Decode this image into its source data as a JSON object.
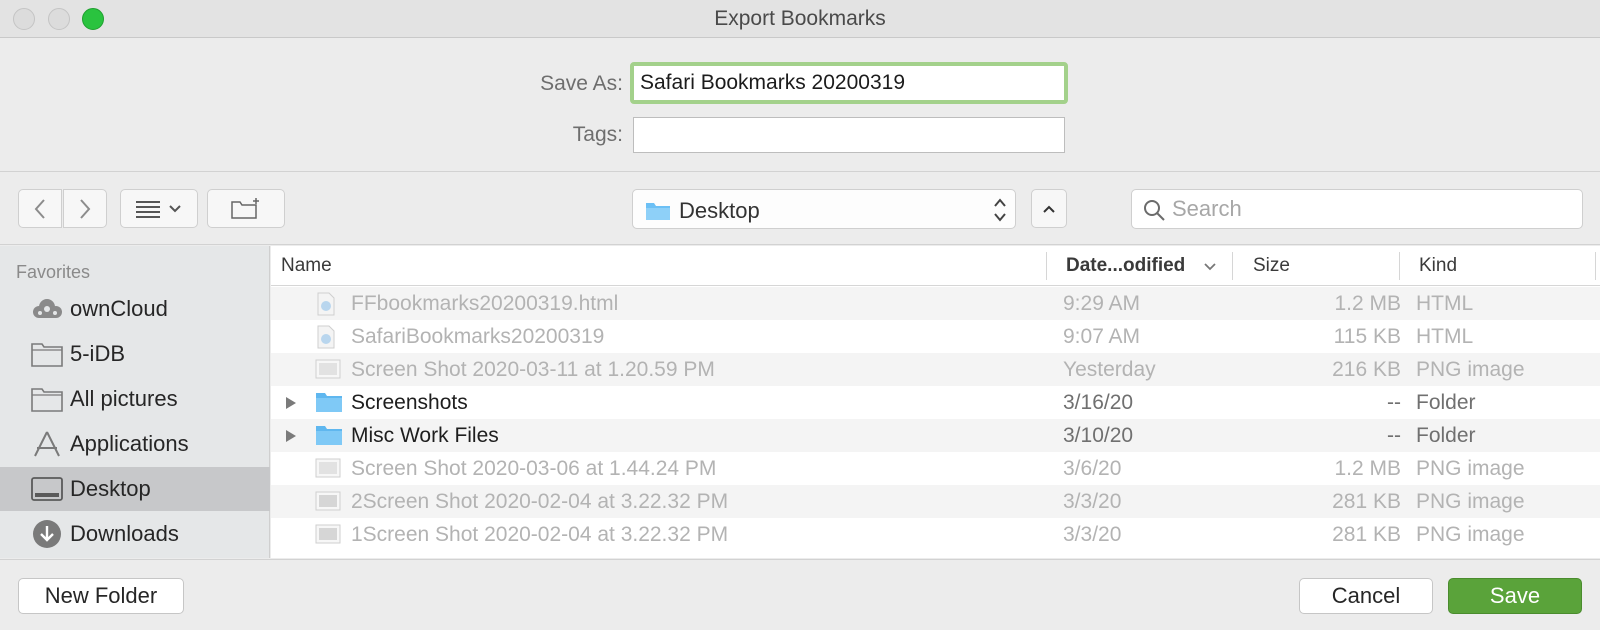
{
  "window": {
    "title": "Export Bookmarks"
  },
  "saveas": {
    "save_as_label": "Save As:",
    "save_as_value": "Safari Bookmarks 20200319",
    "tags_label": "Tags:",
    "tags_value": ""
  },
  "toolbar": {
    "location": "Desktop",
    "search_placeholder": "Search"
  },
  "sidebar": {
    "heading": "Favorites",
    "items": [
      {
        "label": "ownCloud",
        "icon": "cloud-icon"
      },
      {
        "label": "5-iDB",
        "icon": "folder-icon"
      },
      {
        "label": "All pictures",
        "icon": "folder-icon"
      },
      {
        "label": "Applications",
        "icon": "applications-icon"
      },
      {
        "label": "Desktop",
        "icon": "desktop-icon",
        "selected": true
      },
      {
        "label": "Downloads",
        "icon": "downloads-icon"
      }
    ]
  },
  "filelist": {
    "columns": [
      "Name",
      "Date...odified",
      "Size",
      "Kind"
    ],
    "rows": [
      {
        "name": "FFbookmarks20200319.html",
        "date": "9:29 AM",
        "size": "1.2 MB",
        "kind": "HTML",
        "type": "html",
        "enabled": false
      },
      {
        "name": "SafariBookmarks20200319",
        "date": "9:07 AM",
        "size": "115 KB",
        "kind": "HTML",
        "type": "html",
        "enabled": false
      },
      {
        "name": "Screen Shot 2020-03-11 at 1.20.59 PM",
        "date": "Yesterday",
        "size": "216 KB",
        "kind": "PNG image",
        "type": "image",
        "enabled": false
      },
      {
        "name": "Screenshots",
        "date": "3/16/20",
        "size": "--",
        "kind": "Folder",
        "type": "folder",
        "enabled": true
      },
      {
        "name": "Misc Work Files",
        "date": "3/10/20",
        "size": "--",
        "kind": "Folder",
        "type": "folder",
        "enabled": true
      },
      {
        "name": "Screen Shot 2020-03-06 at 1.44.24 PM",
        "date": "3/6/20",
        "size": "1.2 MB",
        "kind": "PNG image",
        "type": "image",
        "enabled": false
      },
      {
        "name": "2Screen Shot 2020-02-04 at 3.22.32 PM",
        "date": "3/3/20",
        "size": "281 KB",
        "kind": "PNG image",
        "type": "image",
        "enabled": false
      },
      {
        "name": "1Screen Shot 2020-02-04 at 3.22.32 PM",
        "date": "3/3/20",
        "size": "281 KB",
        "kind": "PNG image",
        "type": "image",
        "enabled": false
      }
    ]
  },
  "buttons": {
    "new_folder": "New Folder",
    "cancel": "Cancel",
    "save": "Save"
  },
  "colors": {
    "accent_green": "#5aa33a",
    "focus_ring": "#a3d18b",
    "folder_blue": "#6cc0f5"
  }
}
